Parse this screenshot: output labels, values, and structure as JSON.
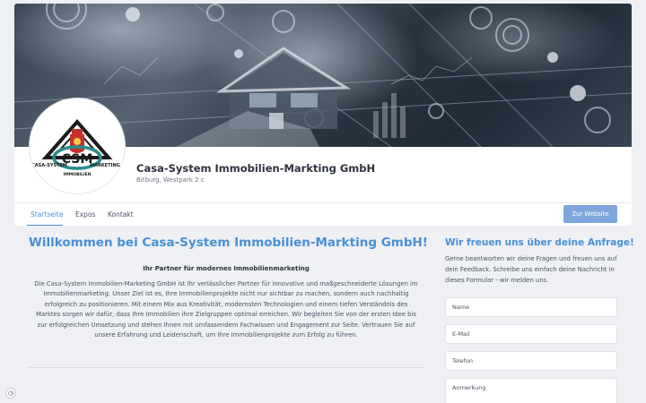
{
  "company": {
    "name": "Casa-System Immobilien-Markting GmbH",
    "address": "Bitburg, Westpark 2 c"
  },
  "logo": {
    "monogram": "CSM",
    "text_left": "CASA-SYSTEM",
    "text_right": "MARKETING",
    "text_bottom": "IMMOBILIEN"
  },
  "tabs": [
    {
      "label": "Startseite",
      "active": true
    },
    {
      "label": "Expos",
      "active": false
    },
    {
      "label": "Kontakt",
      "active": false
    }
  ],
  "website_button": "Zur Website",
  "main": {
    "heading": "Willkommen bei Casa-System Immobilien-Markting GmbH!",
    "subheading": "Ihr Partner für modernes Immobilienmarketing",
    "intro": "Die Casa-System Immobilien-Marketing GmbH ist Ihr verlässlicher Partner für innovative und maßgeschneiderte Lösungen im Immobilienmarketing. Unser Ziel ist es, Ihre Immobilienprojekte nicht nur sichtbar zu machen, sondern auch nachhaltig erfolgreich zu positionieren. Mit einem Mix aus Kreativität, modernsten Technologien und einem tiefen Verständnis des Marktes sorgen wir dafür, dass Ihre Immobilien ihre Zielgruppen optimal erreichen. Wir begleiten Sie von der ersten Idee bis zur erfolgreichen Umsetzung und stehen Ihnen mit umfassendem Fachwissen und Engagement zur Seite. Vertrauen Sie auf unsere Erfahrung und Leidenschaft, um Ihre Immobilienprojekte zum Erfolg zu führen."
  },
  "contact_form": {
    "title": "Wir freuen uns über deine Anfrage!",
    "description": "Gerne beantworten wir deine Fragen und freuen uns auf dein Feedback. Schreibe uns einfach deine Nachricht in dieses Formular - wir melden uns.",
    "name_placeholder": "Name",
    "email_placeholder": "E-Mail",
    "phone_placeholder": "Telefon",
    "message_placeholder": "Anmerkung"
  },
  "colors": {
    "accent": "#4a8fd6",
    "button": "#7fa6dc",
    "background": "#eef0f4"
  },
  "icons": [
    "cookie-settings-icon"
  ]
}
